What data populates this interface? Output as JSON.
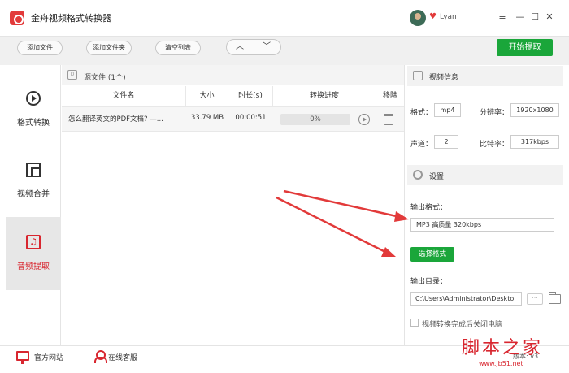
{
  "window": {
    "title": "金舟视频格式转换器",
    "username": "Lyan",
    "controls": [
      "≡",
      "—",
      "☐",
      "✕"
    ]
  },
  "toolbar": {
    "add_file": "添加文件",
    "add_folder": "添加文件夹",
    "clear_list": "清空列表",
    "move_up": "︿",
    "move_down": "﹀",
    "start": "开始提取"
  },
  "sidebar": {
    "items": [
      {
        "label": "格式转换",
        "icon": "play-circle-icon"
      },
      {
        "label": "视频合并",
        "icon": "merge-icon"
      },
      {
        "label": "音频提取",
        "icon": "audio-file-icon",
        "glyph": "♫"
      }
    ],
    "active_index": 2
  },
  "files": {
    "header_label": "源文件 (1个)",
    "header_icon": "D",
    "columns": [
      "文件名",
      "大小",
      "时长(s)",
      "转换进度",
      "移除"
    ],
    "rows": [
      {
        "name": "怎么翻译英文的PDF文档? —...",
        "size": "33.79 MB",
        "duration": "00:00:51",
        "progress_text": "0%",
        "progress": 0
      }
    ]
  },
  "video_info": {
    "title": "视频信息",
    "format_label": "格式：",
    "format_value": "mp4",
    "resolution_label": "分辨率：",
    "resolution_value": "1920x1080",
    "channels_label": "声道：",
    "channels_value": "2",
    "bitrate_label": "比特率：",
    "bitrate_value": "317kbps"
  },
  "settings": {
    "title": "设置",
    "output_format_label": "输出格式：",
    "output_format_value": "MP3 高质量 320kbps",
    "select_format_button": "选择格式",
    "output_dir_label": "输出目录：",
    "output_dir_value": "C:\\Users\\Administrator\\Deskto",
    "more_button": "···",
    "shutdown_label": "视频转换完成后关闭电脑",
    "shutdown_checked": false
  },
  "footer": {
    "website": "官方网站",
    "support": "在线客服",
    "version": "版本: v3."
  },
  "watermark": {
    "text": "脚本之家",
    "url": "www.jb51.net"
  },
  "colors": {
    "accent_red": "#d8262f",
    "accent_green": "#1aa63a",
    "annotation_arrow": "#e23a3a"
  }
}
